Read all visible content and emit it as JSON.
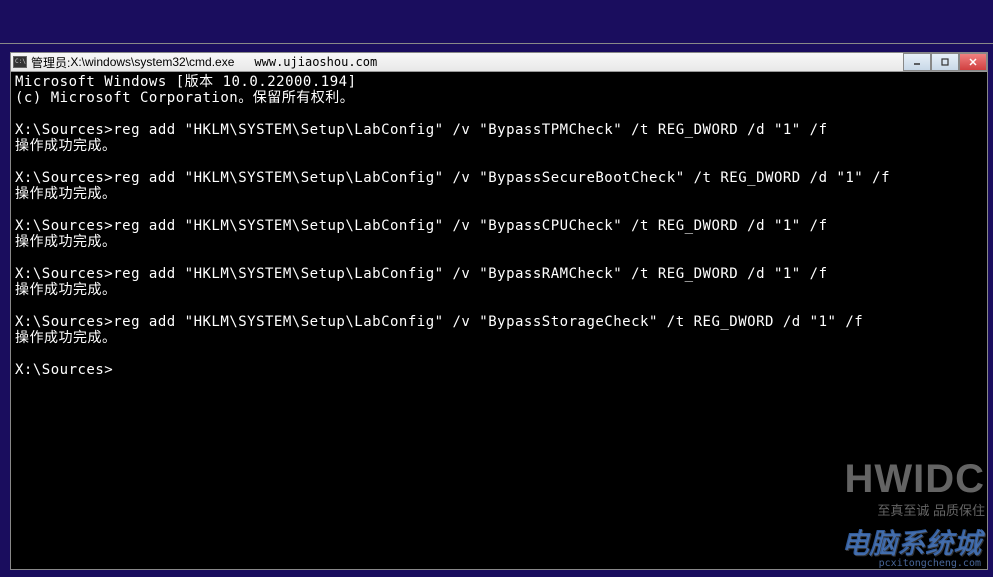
{
  "titlebar": {
    "prefix": "管理员: ",
    "path": "X:\\windows\\system32\\cmd.exe",
    "url": "www.ujiaoshou.com"
  },
  "terminal": {
    "lines": [
      "Microsoft Windows [版本 10.0.22000.194]",
      "(c) Microsoft Corporation。保留所有权利。",
      "",
      "X:\\Sources>reg add \"HKLM\\SYSTEM\\Setup\\LabConfig\" /v \"BypassTPMCheck\" /t REG_DWORD /d \"1\" /f",
      "操作成功完成。",
      "",
      "X:\\Sources>reg add \"HKLM\\SYSTEM\\Setup\\LabConfig\" /v \"BypassSecureBootCheck\" /t REG_DWORD /d \"1\" /f",
      "操作成功完成。",
      "",
      "X:\\Sources>reg add \"HKLM\\SYSTEM\\Setup\\LabConfig\" /v \"BypassCPUCheck\" /t REG_DWORD /d \"1\" /f",
      "操作成功完成。",
      "",
      "X:\\Sources>reg add \"HKLM\\SYSTEM\\Setup\\LabConfig\" /v \"BypassRAMCheck\" /t REG_DWORD /d \"1\" /f",
      "操作成功完成。",
      "",
      "X:\\Sources>reg add \"HKLM\\SYSTEM\\Setup\\LabConfig\" /v \"BypassStorageCheck\" /t REG_DWORD /d \"1\" /f",
      "操作成功完成。",
      "",
      "X:\\Sources>"
    ]
  },
  "watermark": {
    "main": "HWIDC",
    "sub": "至真至诚 品质保住"
  },
  "watermark2": {
    "main": "电脑系统城",
    "sub": "pcxitongcheng.com"
  }
}
